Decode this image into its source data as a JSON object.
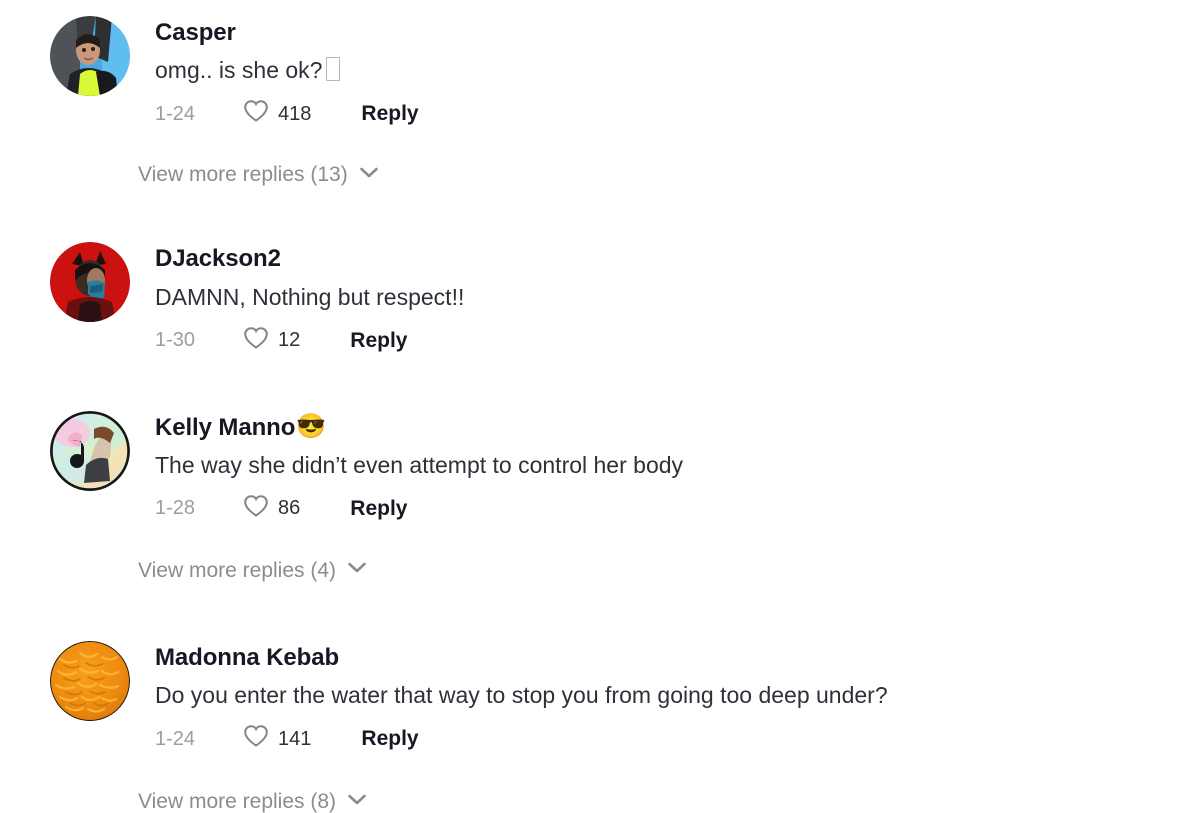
{
  "page": {
    "title": "TikTok comment thread",
    "background_color": "#ffffff",
    "text_color": "#161823",
    "muted_color": "#9b9da3"
  },
  "icons": {
    "heart": "heart-outline-icon",
    "chevron": "chevron-down-icon"
  },
  "comments": [
    {
      "username": "Casper",
      "username_emoji": "",
      "text": "omg.. is she ok?",
      "has_tofu": true,
      "date": "1-24",
      "likes": "418",
      "reply_label": "Reply",
      "avatar": "avatar-casper",
      "view_more": {
        "label": "View more replies (13)",
        "count": "13"
      }
    },
    {
      "username": "DJackson2",
      "username_emoji": "",
      "text": "DAMNN, Nothing but respect!!",
      "has_tofu": false,
      "date": "1-30",
      "likes": "12",
      "reply_label": "Reply",
      "avatar": "avatar-djackson2",
      "view_more": null
    },
    {
      "username": "Kelly Manno",
      "username_emoji": "😎",
      "text": "The way she didn’t even attempt to control her body",
      "has_tofu": false,
      "date": "1-28",
      "likes": "86",
      "reply_label": "Reply",
      "avatar": "avatar-kelly-manno",
      "view_more": {
        "label": "View more replies (4)",
        "count": "4"
      }
    },
    {
      "username": "Madonna Kebab",
      "username_emoji": "",
      "text": "Do you enter the water that way to stop you from going too deep under?",
      "has_tofu": false,
      "date": "1-24",
      "likes": "141",
      "reply_label": "Reply",
      "avatar": "avatar-madonna-kebab",
      "view_more": {
        "label": "View more replies (8)",
        "count": "8"
      }
    }
  ]
}
